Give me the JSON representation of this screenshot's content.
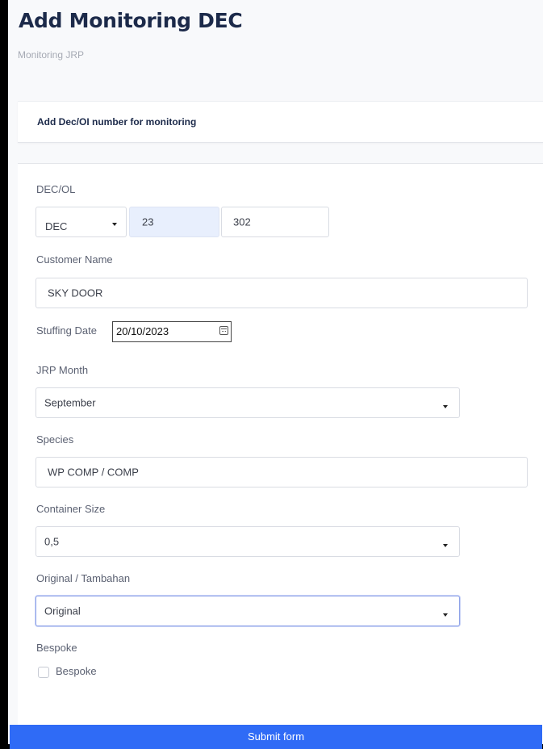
{
  "page": {
    "title": "Add Monitoring DEC",
    "breadcrumb": "Monitoring JRP"
  },
  "card": {
    "header": "Add Dec/OI number for monitoring"
  },
  "form": {
    "dec_ol": {
      "label": "DEC/OL",
      "type_value": "DEC",
      "year_value": "23",
      "number_value": "302"
    },
    "customer_name": {
      "label": "Customer Name",
      "value": "SKY DOOR"
    },
    "stuffing_date": {
      "label": "Stuffing Date",
      "value": "20/10/2023",
      "icon": "calendar-icon"
    },
    "jrp_month": {
      "label": "JRP Month",
      "value": "September"
    },
    "species": {
      "label": "Species",
      "value": "WP COMP / COMP"
    },
    "container_size": {
      "label": "Container Size",
      "value": "0,5"
    },
    "original_tambahan": {
      "label": "Original / Tambahan",
      "value": "Original"
    },
    "bespoke": {
      "label": "Bespoke",
      "checkbox_label": "Bespoke",
      "checked": false
    },
    "submit_label": "Submit form"
  },
  "colors": {
    "accent": "#2f6bf6",
    "title": "#1c2a4a",
    "focus_border": "#8ea2e8",
    "year_field_bg": "#e8effd"
  }
}
